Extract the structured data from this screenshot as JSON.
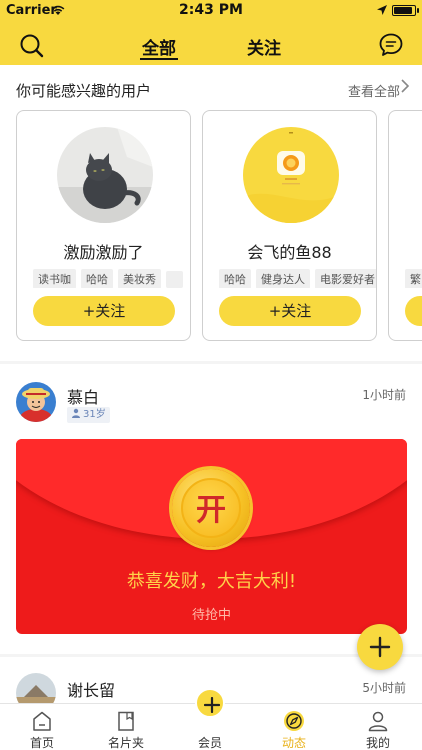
{
  "status_bar": {
    "carrier": "Carrier",
    "time": "2:43 PM"
  },
  "header": {
    "tabs": [
      {
        "label": "全部",
        "active": true
      },
      {
        "label": "关注",
        "active": false
      }
    ],
    "accent_color": "#f8d93f"
  },
  "suggestions": {
    "title": "你可能感兴趣的用户",
    "see_all": "查看全部",
    "cards": [
      {
        "name": "激励激励了",
        "tags": [
          "读书咖",
          "哈哈",
          "美妆秀"
        ],
        "follow_label": "+关注"
      },
      {
        "name": "会飞的鱼88",
        "tags": [
          "哈哈",
          "健身达人",
          "电影爱好者"
        ],
        "follow_label": "+关注"
      },
      {
        "tags": [
          "繁"
        ]
      }
    ]
  },
  "feed": [
    {
      "user": "慕白",
      "age": "31岁",
      "time": "1小时前",
      "red_packet": {
        "coin_text": "开",
        "greeting": "恭喜发财，大吉大利!",
        "status": "待抢中"
      }
    },
    {
      "user": "谢长留",
      "time": "5小时前"
    }
  ],
  "tabbar": [
    {
      "label": "首页",
      "icon": "home-icon",
      "active": false
    },
    {
      "label": "名片夹",
      "icon": "card-holder-icon",
      "active": false
    },
    {
      "label": "会员",
      "icon": "plus-icon",
      "active": false
    },
    {
      "label": "动态",
      "icon": "compass-icon",
      "active": true
    },
    {
      "label": "我的",
      "icon": "profile-icon",
      "active": false
    }
  ],
  "active_color": "#e9b21b",
  "red_packet_color": "#ee1b1b"
}
